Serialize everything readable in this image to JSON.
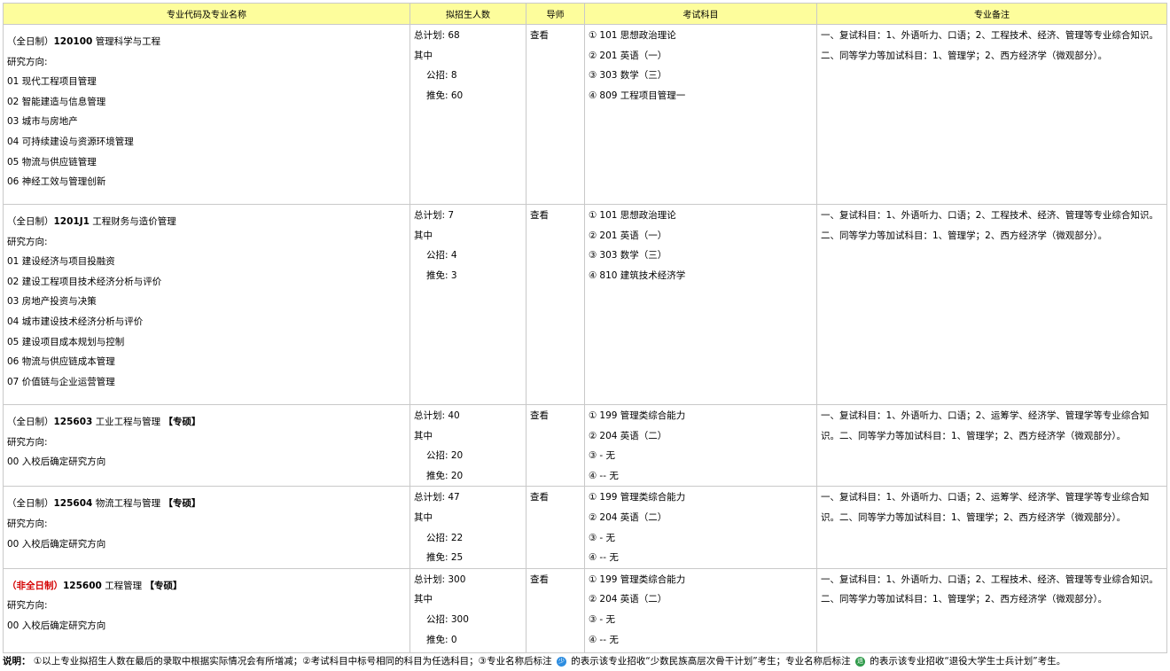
{
  "headers": [
    "专业代码及专业名称",
    "拟招生人数",
    "导师",
    "考试科目",
    "专业备注"
  ],
  "rows": [
    {
      "mode": "（全日制）",
      "code": "120100",
      "name": "管理科学与工程",
      "tag": "",
      "direction_label": "研究方向:",
      "directions": [
        "01 现代工程项目管理",
        "02 智能建造与信息管理",
        "03 城市与房地产",
        "04 可持续建设与资源环境管理",
        "05 物流与供应链管理",
        "06 神经工效与管理创新"
      ],
      "quota": [
        "总计划:  68",
        "其中",
        "公招:  8",
        "推免:  60"
      ],
      "tutor": "查看",
      "subjects": [
        {
          "mark": "1",
          "text": "101 思想政治理论"
        },
        {
          "mark": "2",
          "text": "201 英语（一）"
        },
        {
          "mark": "3",
          "text": "303 数学（三）"
        },
        {
          "mark": "4",
          "text": "809 工程项目管理一"
        }
      ],
      "remark": "一、复试科目：1、外语听力、口语；2、工程技术、经济、管理等专业综合知识。二、同等学力等加试科目：1、管理学；2、西方经济学（微观部分）。"
    },
    {
      "mode": "（全日制）",
      "code": "1201J1",
      "name": "工程财务与造价管理",
      "tag": "",
      "direction_label": "研究方向:",
      "directions": [
        "01 建设经济与项目投融资",
        "02 建设工程项目技术经济分析与评价",
        "03 房地产投资与决策",
        "04 城市建设技术经济分析与评价",
        "05 建设项目成本规划与控制",
        "06 物流与供应链成本管理",
        "07 价值链与企业运营管理"
      ],
      "quota": [
        "总计划:  7",
        "其中",
        "公招:  4",
        "推免:  3"
      ],
      "tutor": "查看",
      "subjects": [
        {
          "mark": "1",
          "text": "101 思想政治理论"
        },
        {
          "mark": "2",
          "text": "201 英语（一）"
        },
        {
          "mark": "3",
          "text": "303 数学（三）"
        },
        {
          "mark": "4",
          "text": "810 建筑技术经济学"
        }
      ],
      "remark": "一、复试科目：1、外语听力、口语；2、工程技术、经济、管理等专业综合知识。二、同等学力等加试科目：1、管理学；2、西方经济学（微观部分）。"
    },
    {
      "mode": "（全日制）",
      "code": "125603",
      "name": "工业工程与管理",
      "tag": "【专硕】",
      "direction_label": "研究方向:",
      "directions": [
        "00 入校后确定研究方向"
      ],
      "quota": [
        "总计划:  40",
        "其中",
        "公招:  20",
        "推免:  20"
      ],
      "tutor": "查看",
      "subjects": [
        {
          "mark": "1",
          "text": "199 管理类综合能力"
        },
        {
          "mark": "2",
          "text": "204 英语（二）"
        },
        {
          "mark": "3",
          "text": "- 无"
        },
        {
          "mark": "4",
          "text": "-- 无"
        }
      ],
      "remark": "一、复试科目：1、外语听力、口语；2、运筹学、经济学、管理学等专业综合知识。二、同等学力等加试科目：1、管理学；2、西方经济学（微观部分）。"
    },
    {
      "mode": "（全日制）",
      "code": "125604",
      "name": "物流工程与管理",
      "tag": "【专硕】",
      "direction_label": "研究方向:",
      "directions": [
        "00 入校后确定研究方向"
      ],
      "quota": [
        "总计划:  47",
        "其中",
        "公招:  22",
        "推免:  25"
      ],
      "tutor": "查看",
      "subjects": [
        {
          "mark": "1",
          "text": "199 管理类综合能力"
        },
        {
          "mark": "2",
          "text": "204 英语（二）"
        },
        {
          "mark": "3",
          "text": "- 无"
        },
        {
          "mark": "4",
          "text": "-- 无"
        }
      ],
      "remark": "一、复试科目：1、外语听力、口语；2、运筹学、经济学、管理学等专业综合知识。二、同等学力等加试科目：1、管理学；2、西方经济学（微观部分）。"
    },
    {
      "mode": "（非全日制）",
      "code": "125600",
      "name": "工程管理",
      "tag": "【专硕】",
      "direction_label": "研究方向:",
      "directions": [
        "00 入校后确定研究方向"
      ],
      "quota": [
        "总计划:  300",
        "其中",
        "公招:  300",
        "推免:  0"
      ],
      "tutor": "查看",
      "subjects": [
        {
          "mark": "1",
          "text": "199 管理类综合能力"
        },
        {
          "mark": "2",
          "text": "204 英语（二）"
        },
        {
          "mark": "3",
          "text": "- 无"
        },
        {
          "mark": "4",
          "text": "-- 无"
        }
      ],
      "remark": "一、复试科目：1、外语听力、口语；2、工程技术、经济、管理等专业综合知识。二、同等学力等加试科目：1、管理学；2、西方经济学（微观部分）。"
    }
  ],
  "note": {
    "label": "说明：",
    "part1": "①以上专业拟招生人数在最后的录取中根据实际情况会有所增减；②考试科目中标号相同的科目为任选科目；③专业名称后标注",
    "badge1": "少",
    "part2": "的表示该专业招收“少数民族高层次骨干计划”考生；专业名称后标注",
    "badge2": "退",
    "part3": "的表示该专业招收“退役大学生士兵计划”考生。"
  },
  "colors": {
    "header_bg": "#fdfd9c",
    "border": "#c9c9c9",
    "part_time_mode": "#d40000"
  }
}
